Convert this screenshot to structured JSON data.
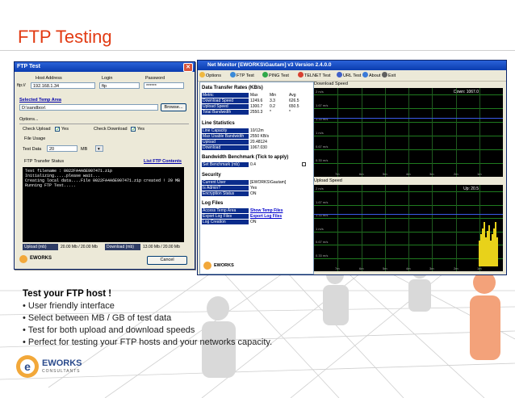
{
  "slide": {
    "title": "FTP Testing"
  },
  "ftp_window": {
    "title": "FTP Test",
    "host_label": "Host Address",
    "login_label": "Login",
    "password_label": "Password",
    "protocol_label": "ftp://",
    "host_value": "192.168.1.34",
    "login_value": "ftp",
    "password_value": "******",
    "temp_area_label": "Selected Temp Area",
    "temp_area_value": "D:\\sandbox\\",
    "browse_label": "Browse...",
    "options_label": "Options...",
    "check_upload_label": "Check Upload",
    "check_upload_yes": "Yes",
    "check_download_label": "Check Download",
    "check_download_yes": "Yes",
    "file_usage_label": "File Usage",
    "test_data_label": "Test Data",
    "test_data_value": "20",
    "unit_value": "MB",
    "transfer_status_label": "FTP Transfer Status",
    "list_contents_label": "List FTP Contents",
    "console_lines": [
      "Test filename : 0022FA4A6E907471.zip",
      "Initializing.....please wait...",
      "Creating local data....File 0022FA4A6E907471.zip created ! 20 MB",
      "Running FTP Test....."
    ],
    "upload_label": "Upload (mb)",
    "upload_value": "20.00 Mb / 20.00 Mb",
    "download_label": "Download (mb)",
    "download_value": "13.00 Mb / 20.00 Mb",
    "cancel_label": "Cancel",
    "logo_text": "EWORKS"
  },
  "net_monitor": {
    "title": "Net Monitor  [EWORKS\\Gautam]   v3  Version 2.4.0.0",
    "toolbar": [
      "Options",
      "FTP Test",
      "PING Test",
      "TELNET Test",
      "URL Test",
      "About",
      "Exit"
    ],
    "rates_header": "Data Transfer Rates (KB/s)",
    "rates_columns": [
      "Metric",
      "Max",
      "Min",
      "Avg"
    ],
    "rates_rows": [
      [
        "Download Speed",
        "1249.6",
        "3.3",
        "626.5"
      ],
      [
        "Upload Speed",
        "1300.7",
        "0.2",
        "650.5"
      ],
      [
        "Total Bandwidth",
        "2550.3",
        "*",
        "*"
      ]
    ],
    "line_header": "Line Statistics",
    "line_rows": [
      [
        "Line Capacity",
        "10/12m"
      ],
      [
        "Max Usable Bandwidth",
        "2550 KB/s"
      ],
      [
        "Upload",
        "20.48124"
      ],
      [
        "Download",
        "1067.030"
      ]
    ],
    "bench_header": "Bandwidth Benchmark (Tick to apply)",
    "bench_rows": [
      [
        "Set Benchmark (mb)",
        "0.4"
      ]
    ],
    "security_header": "Security",
    "security_rows": [
      [
        "Current User",
        "[EWORKS\\Gautam]"
      ],
      [
        "Is Admin?",
        "Yes"
      ],
      [
        "Encryption Status",
        "ON"
      ]
    ],
    "log_header": "Log Files",
    "log_rows": [
      [
        "Access Temp Area",
        "Show Temp Files"
      ],
      [
        "Export Log Files",
        "Export Log Files"
      ],
      [
        "Log Creation",
        "ON"
      ]
    ],
    "download_graph_label": "Download Speed",
    "download_graph_readout": "Down: 1067.0",
    "upload_graph_label": "Upload Speed",
    "upload_graph_readout": "Up: 20.5",
    "y_ticks_download": [
      "2 m/s",
      "1.67 m/s",
      "1.33 m/s",
      "1 m/s",
      "0.67 m/s",
      "0.33 m/s"
    ],
    "y_ticks_upload": [
      "2 m/s",
      "1.67 m/s",
      "1.33 m/s",
      "1 m/s",
      "0.67 m/s",
      "0.33 m/s"
    ],
    "x_ticks": [
      "7m",
      "6m",
      "5m",
      "4m",
      "3m",
      "2m",
      "1m"
    ],
    "logo_text": "EWORKS"
  },
  "body": {
    "subhead": "Test your FTP host !",
    "bullets": [
      "User friendly interface",
      "Select between MB / GB of test data",
      "Test for both upload and download speeds",
      "Perfect for testing your FTP hosts and your networks capacity."
    ],
    "bullet_char": "•"
  },
  "logo": {
    "name": "EWORKS",
    "sub": "CONSULTANTS"
  },
  "colors": {
    "title": "#e23a12",
    "link": "#0000cc",
    "titlebar": "#0a3cb0",
    "graph_bg": "#000000",
    "upload_bars": "#e8d21a"
  }
}
